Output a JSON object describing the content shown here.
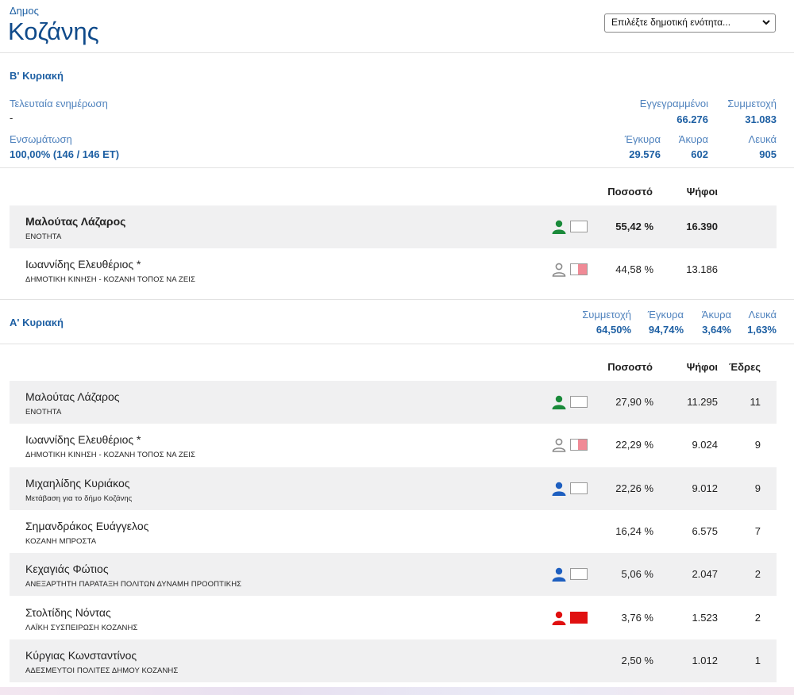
{
  "header": {
    "subtitle": "Δημος",
    "title": "Κοζάνης",
    "select_value": "Επιλέξτε δημοτική ενότητα..."
  },
  "round2": {
    "title": "Β' Κυριακή",
    "last_update_label": "Τελευταία ενημέρωση",
    "last_update_value": "-",
    "integration_label": "Ενσωμάτωση",
    "integration_value": "100,00% (146 / 146 ΕΤ)",
    "registered_label": "Εγγεγραμμένοι",
    "registered_value": "66.276",
    "turnout_label": "Συμμετοχή",
    "turnout_value": "31.083",
    "valid_label": "Έγκυρα",
    "valid_value": "29.576",
    "invalid_label": "Άκυρα",
    "invalid_value": "602",
    "blank_label": "Λευκά",
    "blank_value": "905",
    "col_pct": "Ποσοστό",
    "col_votes": "Ψήφοι",
    "candidates": [
      {
        "name": "Μαλούτας Λάζαρος",
        "party": "ΕΝΟΤΗΤΑ",
        "pct": "55,42 %",
        "votes": "16.390",
        "icon": "person-icon",
        "icon_color": "#1a8a3a",
        "box_color": "#ffffff"
      },
      {
        "name": "Ιωαννίδης Ελευθέριος *",
        "party": "ΔΗΜΟΤΙΚΗ ΚΙΝΗΣΗ - ΚΟΖΑΝΗ ΤΟΠΟΣ ΝΑ ΖΕΙΣ",
        "pct": "44,58 %",
        "votes": "13.186",
        "icon": "person-outline-icon",
        "icon_color": "#8a8a8a",
        "box_color": "#f08a96"
      }
    ]
  },
  "round1": {
    "title": "Α' Κυριακή",
    "turnout_label": "Συμμετοχή",
    "turnout_value": "64,50%",
    "valid_label": "Έγκυρα",
    "valid_value": "94,74%",
    "invalid_label": "Άκυρα",
    "invalid_value": "3,64%",
    "blank_label": "Λευκά",
    "blank_value": "1,63%",
    "col_pct": "Ποσοστό",
    "col_votes": "Ψήφοι",
    "col_seats": "Έδρες",
    "candidates": [
      {
        "name": "Μαλούτας Λάζαρος",
        "party": "ΕΝΟΤΗΤΑ",
        "pct": "27,90 %",
        "votes": "11.295",
        "seats": "11",
        "icon": "person-icon",
        "icon_color": "#1a8a3a",
        "box_color": "#ffffff"
      },
      {
        "name": "Ιωαννίδης Ελευθέριος *",
        "party": "ΔΗΜΟΤΙΚΗ ΚΙΝΗΣΗ - ΚΟΖΑΝΗ ΤΟΠΟΣ ΝΑ ΖΕΙΣ",
        "pct": "22,29 %",
        "votes": "9.024",
        "seats": "9",
        "icon": "person-outline-icon",
        "icon_color": "#8a8a8a",
        "box_color": "#f08a96"
      },
      {
        "name": "Μιχαηλίδης Κυριάκος",
        "party": "Μετάβαση για το δήμο Κοζάνης",
        "pct": "22,26 %",
        "votes": "9.012",
        "seats": "9",
        "icon": "person-icon",
        "icon_color": "#1e5fc0",
        "box_color": "#ffffff"
      },
      {
        "name": "Σημανδράκος Ευάγγελος",
        "party": "ΚΟΖΑΝΗ ΜΠΡΟΣΤΑ",
        "pct": "16,24 %",
        "votes": "6.575",
        "seats": "7",
        "icon": "",
        "icon_color": "",
        "box_color": ""
      },
      {
        "name": "Κεχαγιάς Φώτιος",
        "party": "ΑΝΕΞΑΡΤΗΤΗ ΠΑΡΑΤΑΞΗ ΠΟΛΙΤΩΝ ΔΥΝΑΜΗ ΠΡΟΟΠΤΙΚΗΣ",
        "pct": "5,06 %",
        "votes": "2.047",
        "seats": "2",
        "icon": "person-icon",
        "icon_color": "#1e5fc0",
        "box_color": "#ffffff"
      },
      {
        "name": "Στολτίδης Νόντας",
        "party": "ΛΑΪΚΗ ΣΥΣΠΕΙΡΩΣΗ ΚΟΖΑΝΗΣ",
        "pct": "3,76 %",
        "votes": "1.523",
        "seats": "2",
        "icon": "person-icon",
        "icon_color": "#e01010",
        "box_color": "#e01010"
      },
      {
        "name": "Κύργιας Κωνσταντίνος",
        "party": "ΑΔΕΣΜΕΥΤΟΙ ΠΟΛΙΤΕΣ ΔΗΜΟΥ ΚΟΖΑΝΗΣ",
        "pct": "2,50 %",
        "votes": "1.012",
        "seats": "1",
        "icon": "",
        "icon_color": "",
        "box_color": ""
      }
    ]
  }
}
